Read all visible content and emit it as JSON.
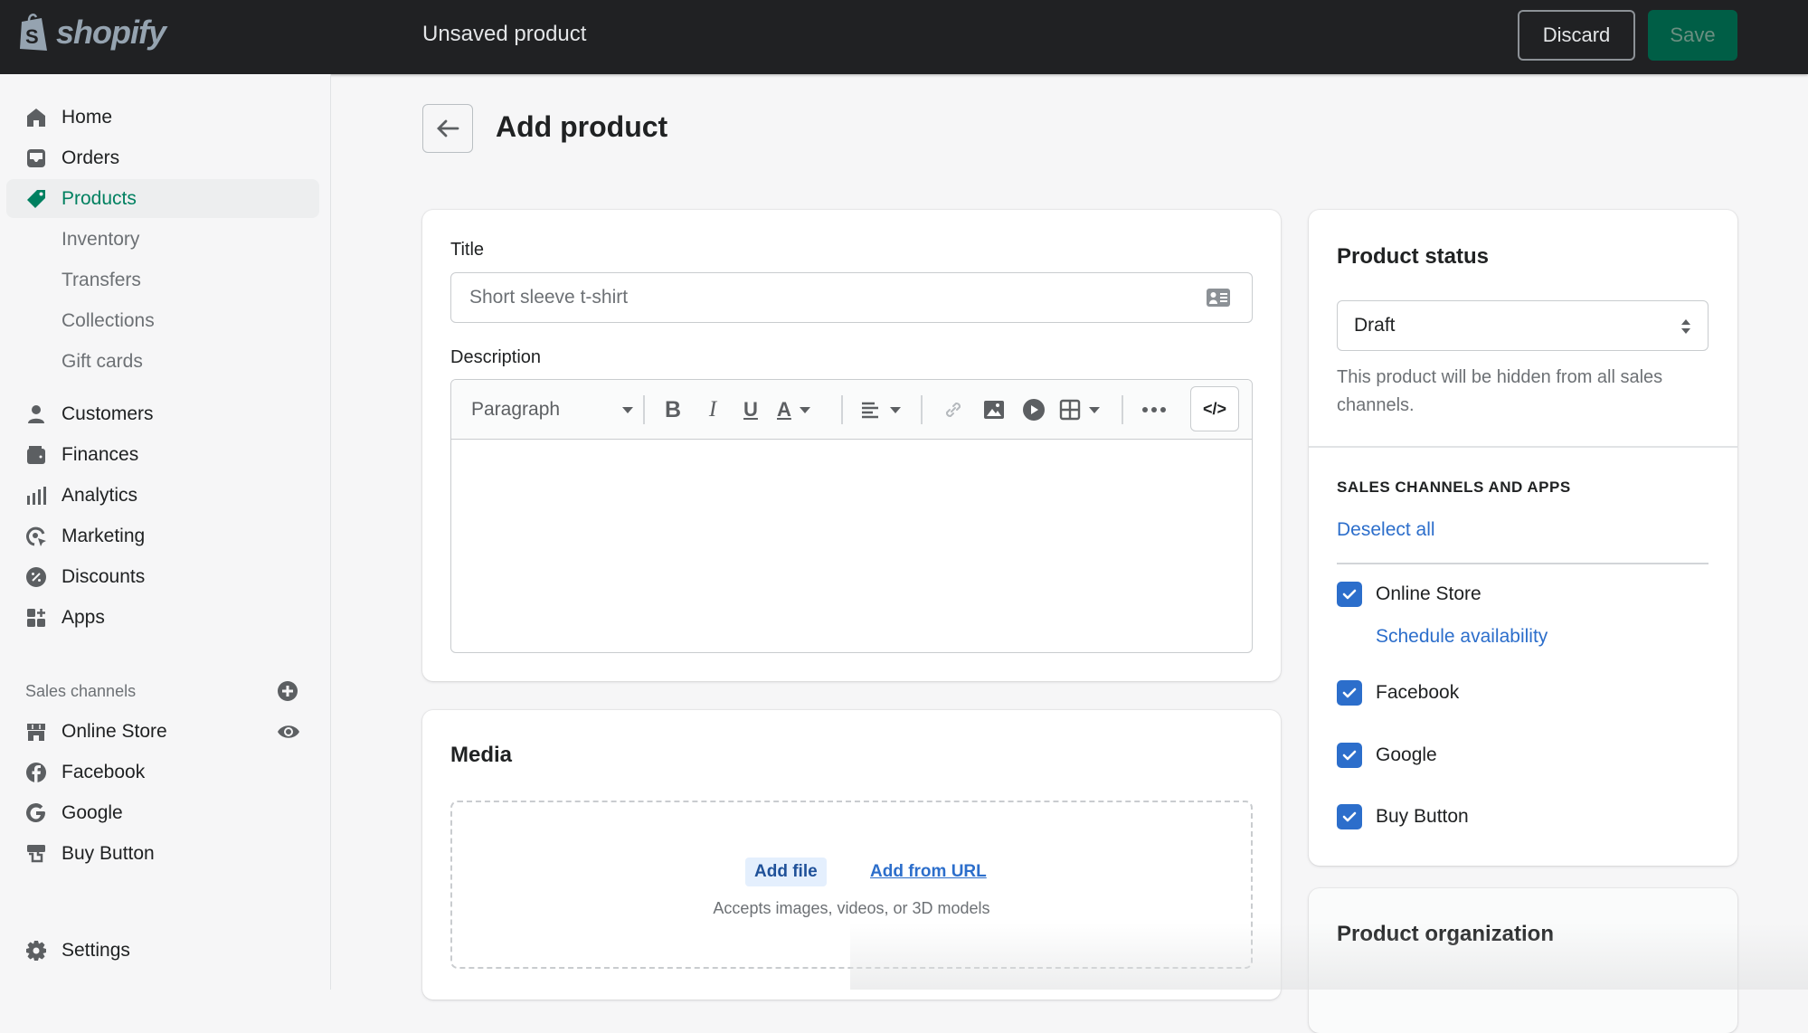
{
  "topbar": {
    "logo_text": "shopify",
    "title": "Unsaved product",
    "discard_label": "Discard",
    "save_label": "Save"
  },
  "sidebar": {
    "items": [
      {
        "label": "Home",
        "icon": "home-icon"
      },
      {
        "label": "Orders",
        "icon": "inbox-icon"
      },
      {
        "label": "Products",
        "icon": "tag-icon",
        "active": true
      },
      {
        "label": "Customers",
        "icon": "person-icon"
      },
      {
        "label": "Finances",
        "icon": "wallet-icon"
      },
      {
        "label": "Analytics",
        "icon": "bar-chart-icon"
      },
      {
        "label": "Marketing",
        "icon": "target-icon"
      },
      {
        "label": "Discounts",
        "icon": "discount-icon"
      },
      {
        "label": "Apps",
        "icon": "apps-icon"
      }
    ],
    "product_subitems": [
      "Inventory",
      "Transfers",
      "Collections",
      "Gift cards"
    ],
    "sales_channels_label": "Sales channels",
    "channels": [
      {
        "label": "Online Store",
        "icon": "store-icon"
      },
      {
        "label": "Facebook",
        "icon": "facebook-icon"
      },
      {
        "label": "Google",
        "icon": "google-icon"
      },
      {
        "label": "Buy Button",
        "icon": "buy-button-icon"
      }
    ],
    "settings_label": "Settings"
  },
  "page": {
    "title": "Add product"
  },
  "product_form": {
    "title_label": "Title",
    "title_placeholder": "Short sleeve t-shirt",
    "description_label": "Description",
    "toolbar": {
      "paragraph_label": "Paragraph",
      "bold": "B",
      "italic": "I",
      "underline": "U",
      "text_color": "A",
      "html": "</>"
    }
  },
  "media": {
    "title": "Media",
    "add_file": "Add file",
    "add_from_url": "Add from URL",
    "accepts": "Accepts images, videos, or 3D models"
  },
  "status": {
    "title": "Product status",
    "selected": "Draft",
    "help": "This product will be hidden from all sales channels.",
    "channels_heading": "SALES CHANNELS AND APPS",
    "deselect_all": "Deselect all",
    "schedule_availability": "Schedule availability",
    "channels": [
      {
        "label": "Online Store",
        "checked": true
      },
      {
        "label": "Facebook",
        "checked": true
      },
      {
        "label": "Google",
        "checked": true
      },
      {
        "label": "Buy Button",
        "checked": true
      }
    ]
  },
  "organization": {
    "title": "Product organization"
  },
  "colors": {
    "topbar": "#202123",
    "brand_green": "#008060",
    "save_bg": "#005e46",
    "link_blue": "#2c6ecb",
    "checkbox_blue": "#2c6ecb"
  }
}
